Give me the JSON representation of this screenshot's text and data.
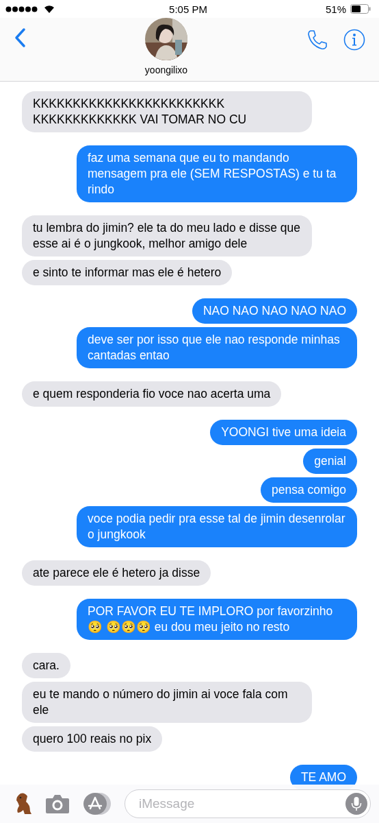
{
  "status_bar": {
    "time": "5:05 PM",
    "battery_percent": "51%"
  },
  "header": {
    "contact_name": "yoongilixo"
  },
  "messages": [
    {
      "kind": "incoming",
      "text": "KKKKKKKKKKKKKKKKKKKKKKKK KKKKKKKKKKKKK VAI TOMAR NO CU"
    },
    {
      "kind": "outgoing",
      "text": "faz uma semana que eu to mandando mensagem pra ele (SEM RESPOSTAS) e tu ta rindo"
    },
    {
      "kind": "incoming",
      "text": "tu lembra do jimin? ele ta do meu lado e disse que esse ai é o jungkook, melhor amigo dele"
    },
    {
      "kind": "incoming",
      "text": "e sinto te informar mas ele é hetero"
    },
    {
      "kind": "outgoing",
      "text": "NAO NAO NAO NAO NAO"
    },
    {
      "kind": "outgoing",
      "text": "deve ser por isso que ele nao responde minhas cantadas entao"
    },
    {
      "kind": "incoming",
      "text": "e quem responderia fio voce nao acerta uma"
    },
    {
      "kind": "outgoing",
      "text": "YOONGI tive uma ideia"
    },
    {
      "kind": "outgoing",
      "text": "genial"
    },
    {
      "kind": "outgoing",
      "text": "pensa comigo"
    },
    {
      "kind": "outgoing",
      "text": "voce podia pedir pra esse tal de jimin desenrolar o jungkook"
    },
    {
      "kind": "incoming",
      "text": "ate parece ele é hetero ja disse"
    },
    {
      "kind": "outgoing",
      "text": "POR FAVOR EU TE IMPLORO por favorzinho 🥺 🥺🥺🥺 eu dou meu jeito no resto"
    },
    {
      "kind": "incoming",
      "text": "cara."
    },
    {
      "kind": "incoming",
      "text": "eu te mando o número do jimin ai voce fala com ele"
    },
    {
      "kind": "incoming",
      "text": "quero 100 reais no pix"
    },
    {
      "kind": "outgoing",
      "text": "TE AMO"
    }
  ],
  "composer": {
    "placeholder": "iMessage"
  }
}
